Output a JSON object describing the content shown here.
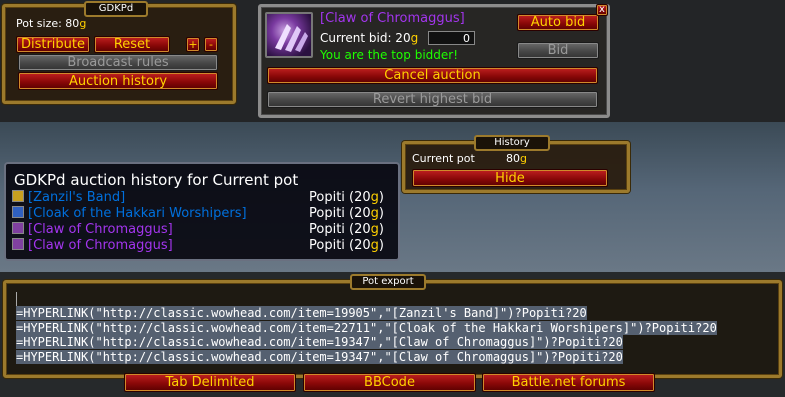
{
  "gdkpd_panel": {
    "title": "GDKPd",
    "pot_size_label": "Pot size: 80",
    "gold_suffix": "g",
    "distribute_label": "Distribute",
    "reset_label": "Reset",
    "plus_label": "+",
    "minus_label": "-",
    "broadcast_label": "Broadcast rules",
    "auction_history_label": "Auction history"
  },
  "auction_panel": {
    "item_name": "[Claw of Chromaggus]",
    "current_bid_label": "Current bid: 20",
    "gold_suffix": "g",
    "bid_input_value": "0",
    "top_bidder_text": "You are the top bidder!",
    "auto_bid_label": "Auto bid",
    "bid_label": "Bid",
    "close_label": "x",
    "cancel_auction_label": "Cancel auction",
    "revert_bid_label": "Revert highest bid"
  },
  "history_panel": {
    "title": "History",
    "current_pot_label": "Current pot",
    "current_pot_value": "80",
    "gold_suffix": "g",
    "hide_label": "Hide"
  },
  "tooltip": {
    "title": "GDKPd auction history for Current pot",
    "rows": [
      {
        "item": "[Zanzil's Band]",
        "quality": "rare",
        "icon_color": "#c8a020",
        "winner": "Popiti (20",
        "g": "g",
        "close": ")"
      },
      {
        "item": "[Cloak of the Hakkari Worshipers]",
        "quality": "rare",
        "icon_color": "#3060c0",
        "winner": "Popiti (20",
        "g": "g",
        "close": ")"
      },
      {
        "item": "[Claw of Chromaggus]",
        "quality": "epic",
        "icon_color": "#8040a0",
        "winner": "Popiti (20",
        "g": "g",
        "close": ")"
      },
      {
        "item": "[Claw of Chromaggus]",
        "quality": "epic",
        "icon_color": "#8040a0",
        "winner": "Popiti (20",
        "g": "g",
        "close": ")"
      }
    ]
  },
  "export_panel": {
    "title": "Pot export",
    "lines": [
      "=HYPERLINK(\"http://classic.wowhead.com/item=19905\",\"[Zanzil's Band]\")?Popiti?20",
      "=HYPERLINK(\"http://classic.wowhead.com/item=22711\",\"[Cloak of the Hakkari Worshipers]\")?Popiti?20",
      "=HYPERLINK(\"http://classic.wowhead.com/item=19347\",\"[Claw of Chromaggus]\")?Popiti?20",
      "=HYPERLINK(\"http://classic.wowhead.com/item=19347\",\"[Claw of Chromaggus]\")?Popiti?20"
    ],
    "tab_delimited_label": "Tab Delimited",
    "bbcode_label": "BBCode",
    "battlenet_label": "Battle.net forums"
  },
  "colors": {
    "gold": "#ffd100",
    "epic": "#a335ee",
    "rare": "#0070dd",
    "green": "#1eff00"
  }
}
